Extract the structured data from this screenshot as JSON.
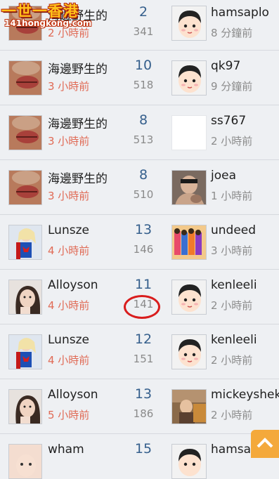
{
  "logo": {
    "text_main": "一世一香港",
    "text_sub": "141hongkong.com"
  },
  "rows": [
    {
      "name": "海邊野生的",
      "time": "2 小時前",
      "replies": "2",
      "views": "341",
      "last_user": "hamsaplo",
      "last_time": "8 分鐘前"
    },
    {
      "name": "海邊野生的",
      "time": "3 小時前",
      "replies": "10",
      "views": "518",
      "last_user": "qk97",
      "last_time": "9 分鐘前"
    },
    {
      "name": "海邊野生的",
      "time": "3 小時前",
      "replies": "8",
      "views": "513",
      "last_user": "ss767",
      "last_time": "2 小時前"
    },
    {
      "name": "海邊野生的",
      "time": "3 小時前",
      "replies": "8",
      "views": "510",
      "last_user": "joea",
      "last_time": "1 小時前"
    },
    {
      "name": "Lunsze",
      "time": "4 小時前",
      "replies": "13",
      "views": "146",
      "last_user": "undeed",
      "last_time": "3 小時前"
    },
    {
      "name": "Alloyson",
      "time": "4 小時前",
      "replies": "11",
      "views": "141",
      "last_user": "kenleeli",
      "last_time": "2 小時前"
    },
    {
      "name": "Lunsze",
      "time": "4 小時前",
      "replies": "12",
      "views": "151",
      "last_user": "kenleeli",
      "last_time": "2 小時前"
    },
    {
      "name": "Alloyson",
      "time": "5 小時前",
      "replies": "13",
      "views": "186",
      "last_user": "mickeyshek",
      "last_time": "2 小時前"
    },
    {
      "name": "wham",
      "time": "",
      "replies": "15",
      "views": "",
      "last_user": "hamsaplo",
      "last_time": ""
    }
  ],
  "back_to_top": {
    "label": "頂"
  }
}
